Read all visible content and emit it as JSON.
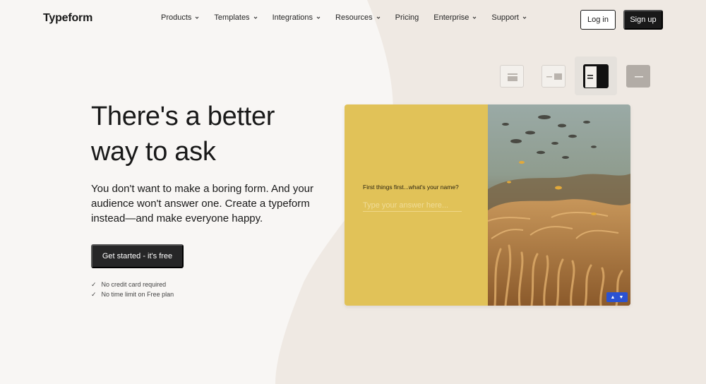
{
  "header": {
    "logo": "Typeform",
    "menu": [
      {
        "label": "Products",
        "has_dropdown": true
      },
      {
        "label": "Templates",
        "has_dropdown": true
      },
      {
        "label": "Integrations",
        "has_dropdown": true
      },
      {
        "label": "Resources",
        "has_dropdown": true
      },
      {
        "label": "Pricing",
        "has_dropdown": false
      },
      {
        "label": "Enterprise",
        "has_dropdown": true
      },
      {
        "label": "Support",
        "has_dropdown": true
      }
    ],
    "login_label": "Log in",
    "signup_label": "Sign up"
  },
  "hero": {
    "headline": "There's a better way to ask",
    "subcopy": "You don't want to make a boring form. And your audience won't answer one. Create a typeform instead—and make everyone happy.",
    "cta_label": "Get started - it's free",
    "checks": [
      "No credit card required",
      "No time limit on Free plan"
    ]
  },
  "layout_options": [
    {
      "name": "layout-stack",
      "selected": false
    },
    {
      "name": "layout-split-small",
      "selected": false
    },
    {
      "name": "layout-split-large",
      "selected": true
    },
    {
      "name": "layout-wallpaper",
      "selected": false
    }
  ],
  "demo_form": {
    "question": "First things first...what's your name?",
    "answer_placeholder": "Type your answer here...",
    "background_color": "#e1c258",
    "nav_icons": [
      "chevron-up-icon",
      "chevron-down-icon"
    ],
    "nav_color": "#2b52d1"
  },
  "colors": {
    "page_bg": "#f8f6f4",
    "blob_bg": "#efe9e3",
    "text": "#191919",
    "button_dark": "#191919"
  }
}
